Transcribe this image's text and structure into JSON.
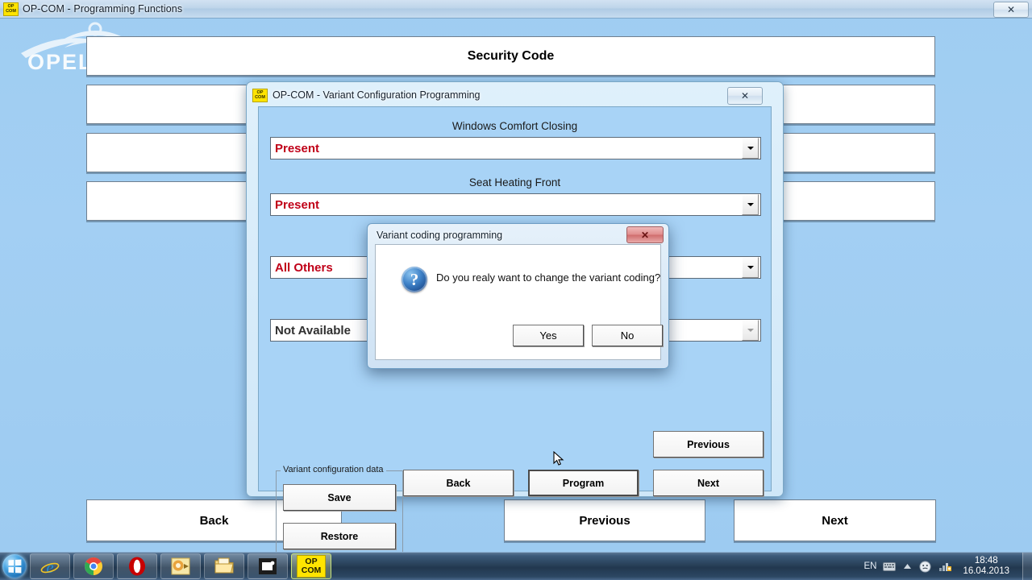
{
  "main_window": {
    "title": "OP-COM - Programming Functions",
    "icon": "opcom-icon",
    "close_label": "✕"
  },
  "branding": {
    "logo_text": "OPEL"
  },
  "background_app": {
    "header": "Security Code",
    "empty_rows": [
      "",
      "",
      ""
    ],
    "buttons": {
      "back": "Back",
      "previous": "Previous",
      "next": "Next"
    }
  },
  "child_window": {
    "title": "OP-COM - Variant Configuration Programming",
    "icon": "opcom-icon",
    "close_label": "✕",
    "fields": [
      {
        "label": "Windows Comfort Closing",
        "value": "Present",
        "value_color": "#c00018",
        "enabled": true
      },
      {
        "label": "Seat Heating Front",
        "value": "Present",
        "value_color": "#c00018",
        "enabled": true
      },
      {
        "label": "",
        "value": "All Others",
        "value_color": "#c00018",
        "enabled": true
      },
      {
        "label": "",
        "value": "Not Available",
        "value_color": "#303030",
        "enabled": false
      }
    ],
    "group_box": {
      "title": "Variant configuration data",
      "save_label": "Save",
      "restore_label": "Restore"
    },
    "buttons": {
      "back": "Back",
      "program": "Program",
      "previous": "Previous",
      "next": "Next"
    }
  },
  "dialog": {
    "title": "Variant coding programming",
    "close_label": "✕",
    "icon": "question-icon",
    "message": "Do you realy want to change the variant coding?",
    "yes_label": "Yes",
    "no_label": "No"
  },
  "taskbar": {
    "start_label": "Start",
    "items": [
      {
        "name": "internet-explorer",
        "label": ""
      },
      {
        "name": "google-chrome",
        "label": ""
      },
      {
        "name": "opera",
        "label": ""
      },
      {
        "name": "outlook",
        "label": ""
      },
      {
        "name": "windows-explorer",
        "label": ""
      },
      {
        "name": "media-app",
        "label": ""
      },
      {
        "name": "opcom",
        "label": "OP COM",
        "line1": "OP",
        "line2": "COM",
        "active": true
      }
    ],
    "tray": {
      "language": "EN",
      "time": "18:48",
      "date": "16.04.2013"
    }
  }
}
